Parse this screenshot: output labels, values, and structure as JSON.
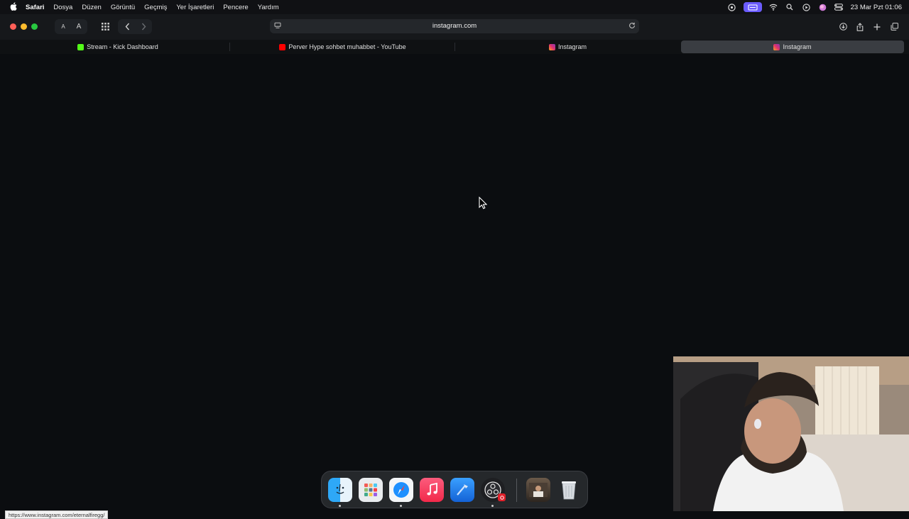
{
  "menubar": {
    "app_name": "Safari",
    "items": [
      "Dosya",
      "Düzen",
      "Görüntü",
      "Geçmiş",
      "Yer İşaretleri",
      "Pencere",
      "Yardım"
    ],
    "clock": "23 Mar Pzt  01:06"
  },
  "toolbar": {
    "text_small": "A",
    "text_large": "A",
    "address": "instagram.com"
  },
  "tabs": [
    {
      "title": "Stream - Kick Dashboard",
      "favicon": "kick-icon",
      "color": "#53fc18"
    },
    {
      "title": "Perver Hype sohbet muhabbet - YouTube",
      "favicon": "youtube-icon",
      "color": "#ff0000"
    },
    {
      "title": "Instagram",
      "favicon": "instagram-icon",
      "color": "#e1306c"
    },
    {
      "title": "Instagram",
      "favicon": "instagram-icon",
      "color": "#e1306c",
      "active": true
    }
  ],
  "status_bar": {
    "link": "https://www.instagram.com/eternalfiregg/"
  },
  "dock": {
    "apps": [
      "Finder",
      "Launchpad",
      "Safari",
      "Music",
      "Xcode",
      "OBS",
      "Photo",
      "Trash"
    ]
  },
  "colors": {
    "accent": "#6b5cff",
    "background": "#0b0d10"
  }
}
